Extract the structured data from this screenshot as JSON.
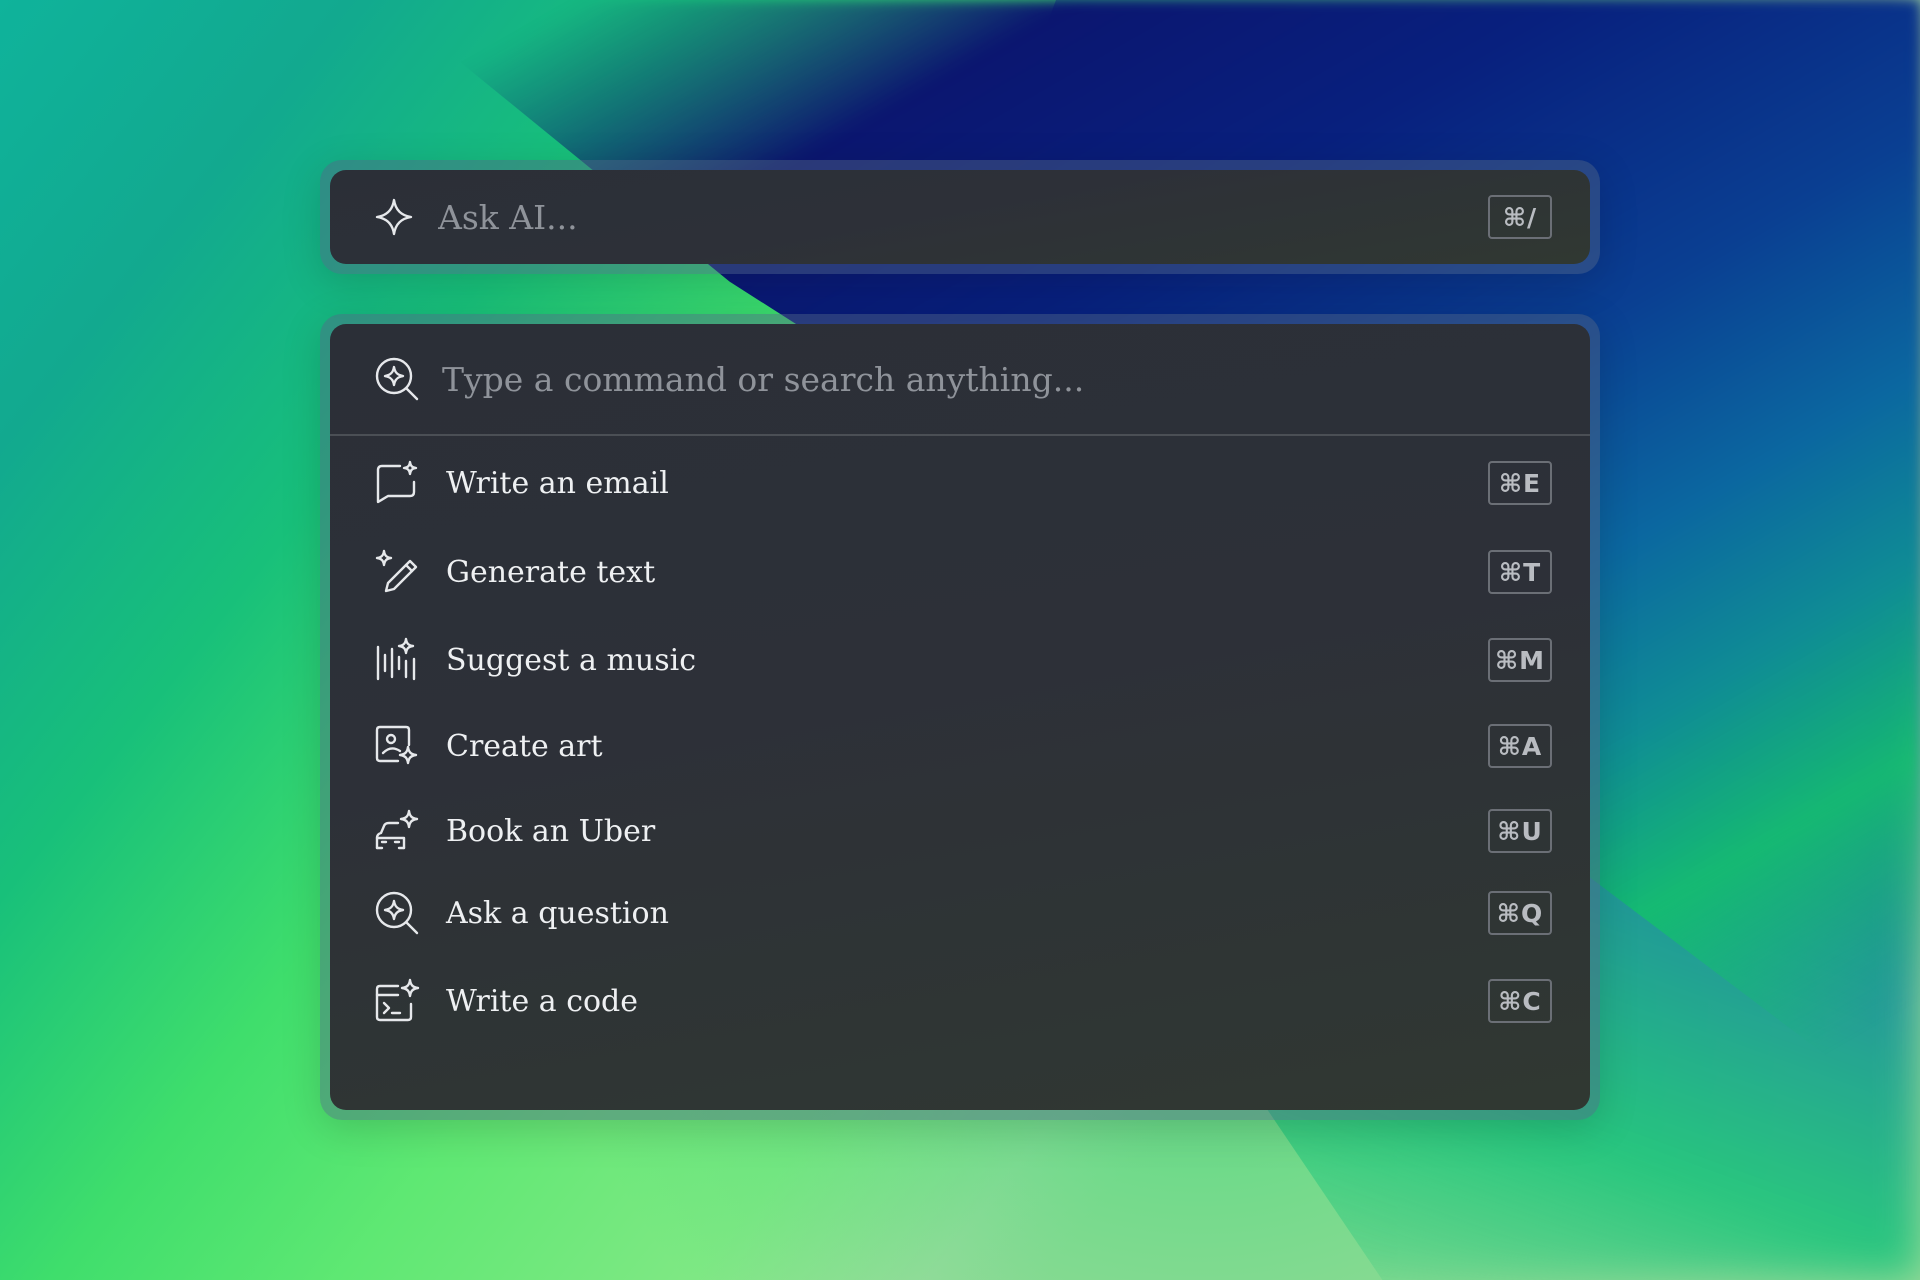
{
  "ask_bar": {
    "icon": "sparkle-icon",
    "placeholder": "Ask AI...",
    "shortcut": "⌘/"
  },
  "command_palette": {
    "search_icon": "search-sparkle-icon",
    "search_placeholder": "Type a command or search anything...",
    "items": [
      {
        "label": "Write an email",
        "icon": "email-sparkle-icon",
        "shortcut": "⌘E"
      },
      {
        "label": "Generate text",
        "icon": "pencil-sparkle-icon",
        "shortcut": "⌘T"
      },
      {
        "label": "Suggest a music",
        "icon": "audio-wave-sparkle-icon",
        "shortcut": "⌘M"
      },
      {
        "label": "Create art",
        "icon": "image-sparkle-icon",
        "shortcut": "⌘A"
      },
      {
        "label": "Book an Uber",
        "icon": "car-sparkle-icon",
        "shortcut": "⌘U"
      },
      {
        "label": "Ask a question",
        "icon": "search-sparkle-icon",
        "shortcut": "⌘Q"
      },
      {
        "label": "Write a code",
        "icon": "terminal-sparkle-icon",
        "shortcut": "⌘C"
      }
    ]
  },
  "colors": {
    "panel_bg": "#2d3038",
    "text_primary": "#eef0f2",
    "text_placeholder": "#8f939a",
    "kbd_border": "#6b6f76"
  }
}
